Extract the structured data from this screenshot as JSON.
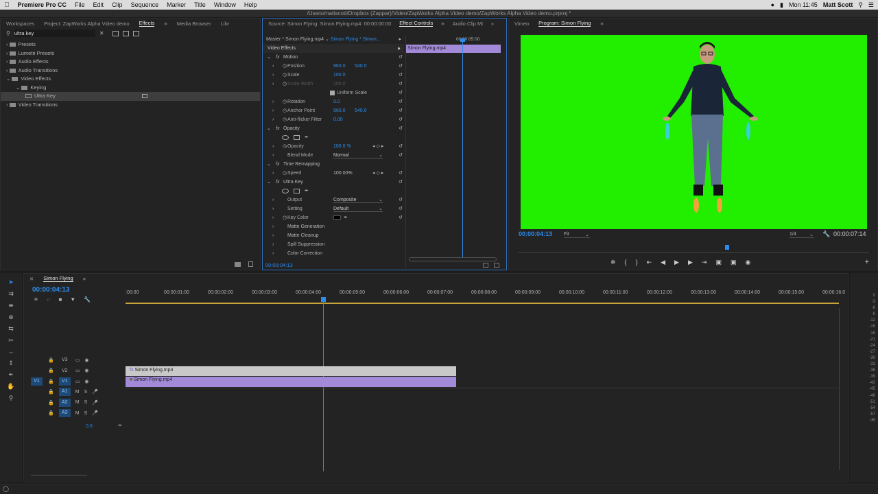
{
  "menubar": {
    "app": "Premiere Pro CC",
    "items": [
      "File",
      "Edit",
      "Clip",
      "Sequence",
      "Marker",
      "Title",
      "Window",
      "Help"
    ],
    "clock": "Mon 11:45",
    "user": "Matt Scott"
  },
  "path": "/Users/mattscott/Dropbox (Zappar)/Video/ZapWorks Alpha Video demo/ZapWorks Alpha Video demo.prproj *",
  "left_panel": {
    "tabs": [
      "Workspaces",
      "Project: ZapWorks Alpha Video demo",
      "Effects",
      "Media Browser",
      "Libr"
    ],
    "search_value": "ultra key",
    "tree": [
      {
        "label": "Presets",
        "lvl": 0
      },
      {
        "label": "Lumetri Presets",
        "lvl": 0
      },
      {
        "label": "Audio Effects",
        "lvl": 0
      },
      {
        "label": "Audio Transitions",
        "lvl": 0
      },
      {
        "label": "Video Effects",
        "lvl": 0,
        "open": true
      },
      {
        "label": "Keying",
        "lvl": 1,
        "open": true
      },
      {
        "label": "Ultra Key",
        "lvl": 2,
        "selected": true
      },
      {
        "label": "Video Transitions",
        "lvl": 0
      }
    ]
  },
  "effect_controls": {
    "tabs": [
      "Source: Simon Flying: Simon Flying.mp4: 00:00:00:00",
      "Effect Controls",
      "Audio Clip Mi"
    ],
    "master": "Master * Simon Flying.mp4",
    "clip": "Simon Flying * Simon...",
    "section": "Video Effects",
    "ruler_time": "00:00:05:00",
    "clip_bar": "Simon Flying.mp4",
    "timecode": "00:00:04:13",
    "motion": "Motion",
    "position_label": "Position",
    "pos_x": "960.0",
    "pos_y": "540.0",
    "scale_label": "Scale",
    "scale_val": "100.0",
    "scale_width_label": "Scale Width",
    "scale_width_val": "100.0",
    "uniform_label": "Uniform Scale",
    "rotation_label": "Rotation",
    "rotation_val": "0.0",
    "anchor_label": "Anchor Point",
    "anchor_x": "960.0",
    "anchor_y": "540.0",
    "antiflicker_label": "Anti-flicker Filter",
    "antiflicker_val": "0.00",
    "opacity_head": "Opacity",
    "opacity_label": "Opacity",
    "opacity_val": "100.0 %",
    "blend_label": "Blend Mode",
    "blend_val": "Normal",
    "timeremap": "Time Remapping",
    "speed_label": "Speed",
    "speed_val": "100.00%",
    "ultrakey": "Ultra Key",
    "output_label": "Output",
    "output_val": "Composite",
    "setting_label": "Setting",
    "setting_val": "Default",
    "keycolor_label": "Key Color",
    "subs": [
      "Matte Generation",
      "Matte Cleanup",
      "Spill Suppression",
      "Color Correction"
    ]
  },
  "program": {
    "tabs": [
      "Vimeo",
      "Program: Simon Flying"
    ],
    "timecode": "00:00:04:13",
    "fit": "Fit",
    "res": "1/4",
    "duration": "00:00:07:14",
    "screen_color": "#22ee00"
  },
  "timeline": {
    "tab": "Simon Flying",
    "timecode": "00:00:04:13",
    "ruler": [
      ":00:00",
      "00:00:01:00",
      "00:00:02:00",
      "00:00:03:00",
      "00:00:04:00",
      "00:00:05:00",
      "00:00:06:00",
      "00:00:07:00",
      "00:00:08:00",
      "00:00:09:00",
      "00:00:10:00",
      "00:00:11:00",
      "00:00:12:00",
      "00:00:13:00",
      "00:00:14:00",
      "00:00:15:00",
      "00:00:16:0"
    ],
    "tracks": [
      {
        "id": "V3"
      },
      {
        "id": "V2"
      },
      {
        "id": "V1",
        "src": "V1"
      },
      {
        "id": "A1"
      },
      {
        "id": "A2"
      },
      {
        "id": "A3"
      }
    ],
    "master_val": "0.0",
    "clip_v2": "Simon Flying.mp4",
    "clip_v1": "Simon Flying.mp4"
  },
  "meter": {
    "labels": [
      "0",
      "-3",
      "-6",
      "-9",
      "-12",
      "-15",
      "-18",
      "-21",
      "-24",
      "-27",
      "-30",
      "-33",
      "-36",
      "-39",
      "-42",
      "-45",
      "-48",
      "-51",
      "-54",
      "-57",
      "dB"
    ]
  }
}
